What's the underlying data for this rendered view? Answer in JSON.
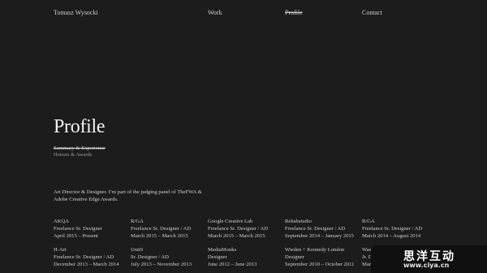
{
  "header": {
    "name": "Tomasz Wysocki",
    "nav": [
      "Work",
      "Profile",
      "Contact"
    ]
  },
  "page_title": "Profile",
  "subnav": [
    "Summary & Experience",
    "Honors & Awards"
  ],
  "bio": "Art Director & Designer. I’m part of the judging panel of TheFWA & Adobe Creative Edge Awards.",
  "jobs": [
    {
      "company": "AKQA",
      "role": "Freelance Sr. Designer",
      "dates": "April 2015 – Present"
    },
    {
      "company": "R/GA",
      "role": "Freelance Sr. Designer / AD",
      "dates": "March 2015 – March 2015"
    },
    {
      "company": "Google Creative Lab",
      "role": "Freelance Sr. Designer / AD",
      "dates": "March 2015 – March 2015"
    },
    {
      "company": "Rehabstudio",
      "role": "Freelance Sr. Designer / AD",
      "dates": "September 2014 – January 2015"
    },
    {
      "company": "R/GA",
      "role": "Freelance Sr. Designer / AD",
      "dates": "March 2014 – August 2014"
    },
    {
      "company": "H-Art",
      "role": "Freelance Sr. Designer / AD",
      "dates": "December 2013 – March 2014"
    },
    {
      "company": "Unit9",
      "role": "Sr. Designer / AD",
      "dates": "July 2013 – November 2013"
    },
    {
      "company": "MediaMonks",
      "role": "Designer",
      "dates": "June 2012 – June 2013"
    },
    {
      "company": "Wieden + Kennedy London",
      "role": "Designer",
      "dates": "September 2010 – October 2011"
    },
    {
      "company": "Waste Cr",
      "role": "Jr. Designe",
      "dates": "March 200"
    }
  ],
  "watermark": {
    "text": "思洋互动",
    "url": "www.ciya.cn"
  },
  "colors": {
    "background": "#1c1c1c",
    "text": "#cfcfcf",
    "muted": "#9b9b9b"
  }
}
